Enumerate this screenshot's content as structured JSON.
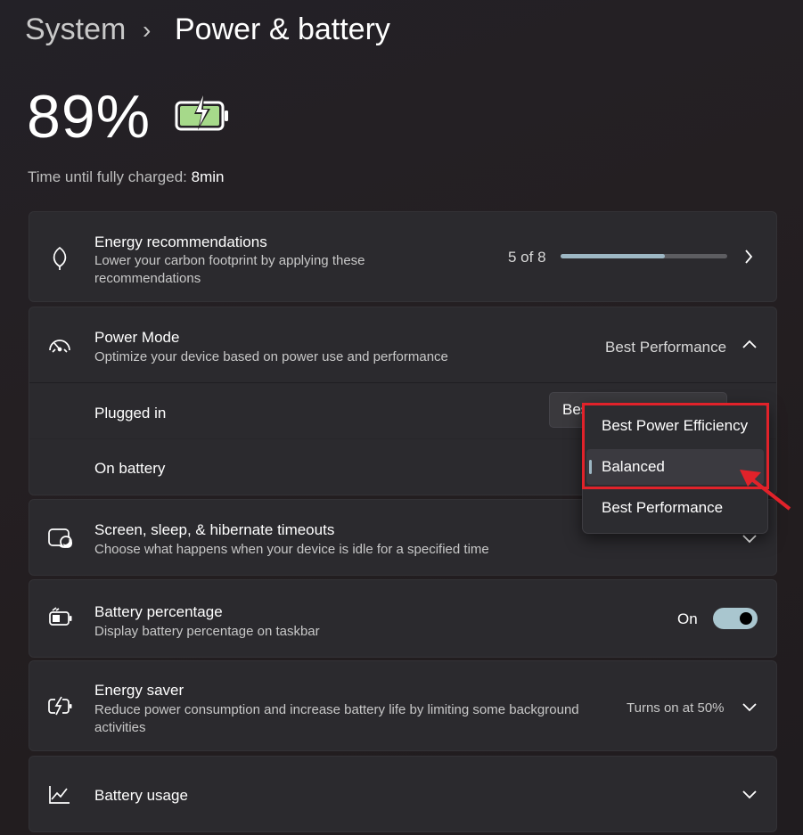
{
  "breadcrumb": {
    "parent": "System",
    "separator": "›",
    "current": "Power & battery"
  },
  "battery": {
    "percent_text": "89%",
    "charge_label": "Time until fully charged:",
    "charge_value": "8min"
  },
  "energy_recommendations": {
    "title": "Energy recommendations",
    "desc": "Lower your carbon footprint by applying these recommendations",
    "progress_text": "5 of 8",
    "progress_fraction": 0.625
  },
  "power_mode": {
    "title": "Power Mode",
    "desc": "Optimize your device based on power use and performance",
    "value": "Best Performance",
    "plugged_in_label": "Plugged in",
    "plugged_in_value": "Best Performance",
    "on_battery_label": "On battery"
  },
  "dropdown": {
    "options": [
      "Best Power Efficiency",
      "Balanced",
      "Best Performance"
    ],
    "selected": "Balanced"
  },
  "screen_sleep": {
    "title": "Screen, sleep, & hibernate timeouts",
    "desc": "Choose what happens when your device is idle for a specified time"
  },
  "battery_percentage": {
    "title": "Battery percentage",
    "desc": "Display battery percentage on taskbar",
    "toggle_label": "On",
    "toggle_on": true
  },
  "energy_saver": {
    "title": "Energy saver",
    "desc": "Reduce power consumption and increase battery life by limiting some background activities",
    "status": "Turns on at 50%"
  },
  "battery_usage": {
    "title": "Battery usage"
  },
  "colors": {
    "accent": "#9db7c4",
    "highlight": "#e1222a",
    "battery_fill": "#a6d98a"
  }
}
